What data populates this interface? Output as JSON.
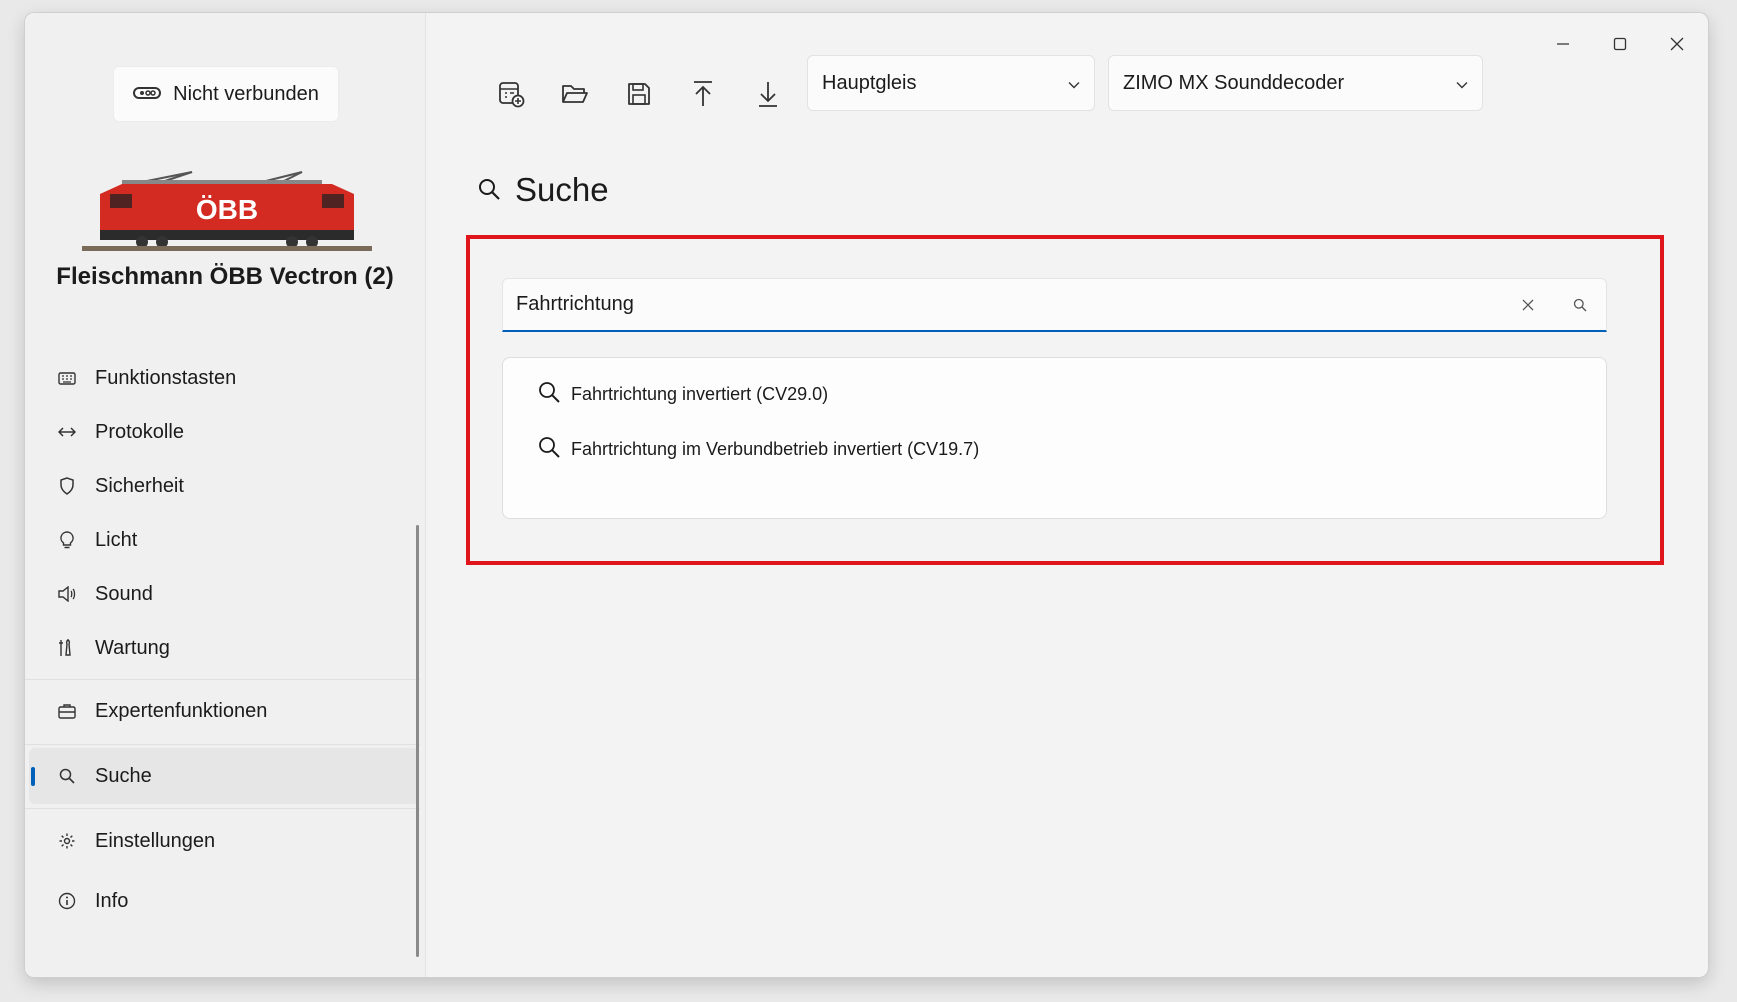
{
  "connection": {
    "label": "Nicht verbunden"
  },
  "loco": {
    "name": "Fleischmann ÖBB Vectron (2)",
    "logo_text": "ÖBB"
  },
  "sidebar": {
    "items": [
      {
        "label": "Funktionstasten",
        "icon": "keyboard-icon"
      },
      {
        "label": "Protokolle",
        "icon": "arrows-left-right-icon"
      },
      {
        "label": "Sicherheit",
        "icon": "shield-icon"
      },
      {
        "label": "Licht",
        "icon": "lightbulb-icon"
      },
      {
        "label": "Sound",
        "icon": "speaker-icon"
      },
      {
        "label": "Wartung",
        "icon": "wrench-icon"
      },
      {
        "label": "Expertenfunktionen",
        "icon": "toolbox-icon"
      },
      {
        "label": "Suche",
        "icon": "search-icon",
        "active": true
      },
      {
        "label": "Einstellungen",
        "icon": "gear-icon"
      },
      {
        "label": "Info",
        "icon": "info-icon"
      }
    ]
  },
  "toolbar": {
    "buttons": [
      "new-file-icon",
      "open-folder-icon",
      "save-icon",
      "upload-icon",
      "download-icon"
    ],
    "track_select": {
      "value": "Hauptgleis"
    },
    "decoder_select": {
      "value": "ZIMO MX Sounddecoder"
    }
  },
  "page": {
    "title": "Suche"
  },
  "search": {
    "value": "Fahrtrichtung",
    "results": [
      "Fahrtrichtung invertiert (CV29.0)",
      "Fahrtrichtung im Verbundbetrieb invertiert (CV19.7)"
    ]
  },
  "colors": {
    "accent": "#005fb8",
    "highlight": "#e0141b",
    "loco_red": "#d32a22"
  }
}
